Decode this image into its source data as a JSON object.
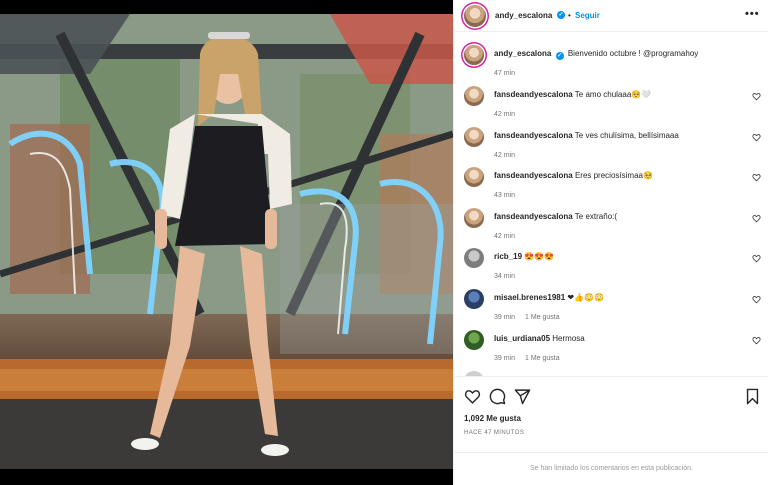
{
  "post": {
    "author": {
      "username": "andy_escalona",
      "verified": true
    },
    "follow_label": "Seguir",
    "separator": "•",
    "more_label": "•••",
    "caption": {
      "username": "andy_escalona",
      "text": "Bienvenido octubre ! @programahoy",
      "time": "47 min"
    },
    "likes": "1,092 Me gusta",
    "posted_ago": "HACE 47 MINUTOS",
    "comments_limited": "Se han limitado los comentarios en esta publicación."
  },
  "comments": [
    {
      "username": "fansdeandyescalona",
      "text": "Te amo chulaaa🥺🤍",
      "time": "42 min",
      "likes": ""
    },
    {
      "username": "fansdeandyescalona",
      "text": "Te ves chulísima, bellísimaaa",
      "time": "42 min",
      "likes": ""
    },
    {
      "username": "fansdeandyescalona",
      "text": "Eres preciosísimaa🥺",
      "time": "43 min",
      "likes": ""
    },
    {
      "username": "fansdeandyescalona",
      "text": "Te extraño:(",
      "time": "42 min",
      "likes": ""
    },
    {
      "username": "ricb_19",
      "text": "😍😍😍",
      "time": "34 min",
      "likes": ""
    },
    {
      "username": "misael.brenes1981",
      "text": "❤👍😳😳",
      "time": "39 min",
      "likes": "1 Me gusta"
    },
    {
      "username": "luis_urdiana05",
      "text": "Hermosa",
      "time": "39 min",
      "likes": "1 Me gusta"
    }
  ],
  "icons": {
    "like": "heart-icon",
    "comment": "comment-icon",
    "share": "share-icon",
    "save": "bookmark-icon",
    "more": "more-options-icon",
    "verified": "verified-badge-icon"
  },
  "colors": {
    "accent": "#0095f6",
    "text": "#262626",
    "muted": "#737373"
  }
}
